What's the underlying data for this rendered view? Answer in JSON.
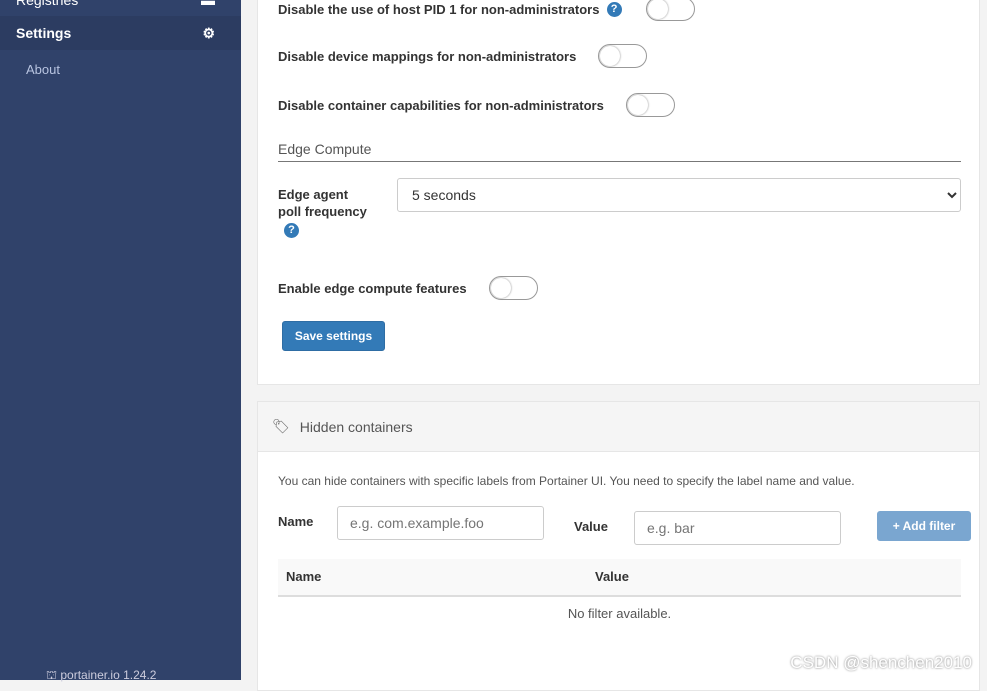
{
  "sidebar": {
    "prev_item": "Registries",
    "settings": "Settings",
    "about": "About",
    "footer": "portainer.io 1.24.2"
  },
  "security": {
    "host_pid": "Disable the use of host PID 1 for non-administrators",
    "device_mappings": "Disable device mappings for non-administrators",
    "capabilities": "Disable container capabilities for non-administrators",
    "help": "?"
  },
  "edge": {
    "title": "Edge Compute",
    "poll_label": "Edge agent poll frequency",
    "poll_value": "5 seconds",
    "enable_label": "Enable edge compute features",
    "save": "Save settings"
  },
  "hidden": {
    "title": "Hidden containers",
    "description": "You can hide containers with specific labels from Portainer UI. You need to specify the label name and value.",
    "name_label": "Name",
    "name_placeholder": "e.g. com.example.foo",
    "value_label": "Value",
    "value_placeholder": "e.g. bar",
    "add": "+ Add filter",
    "col_name": "Name",
    "col_value": "Value",
    "empty": "No filter available."
  },
  "watermark": "CSDN @shenchen2010"
}
